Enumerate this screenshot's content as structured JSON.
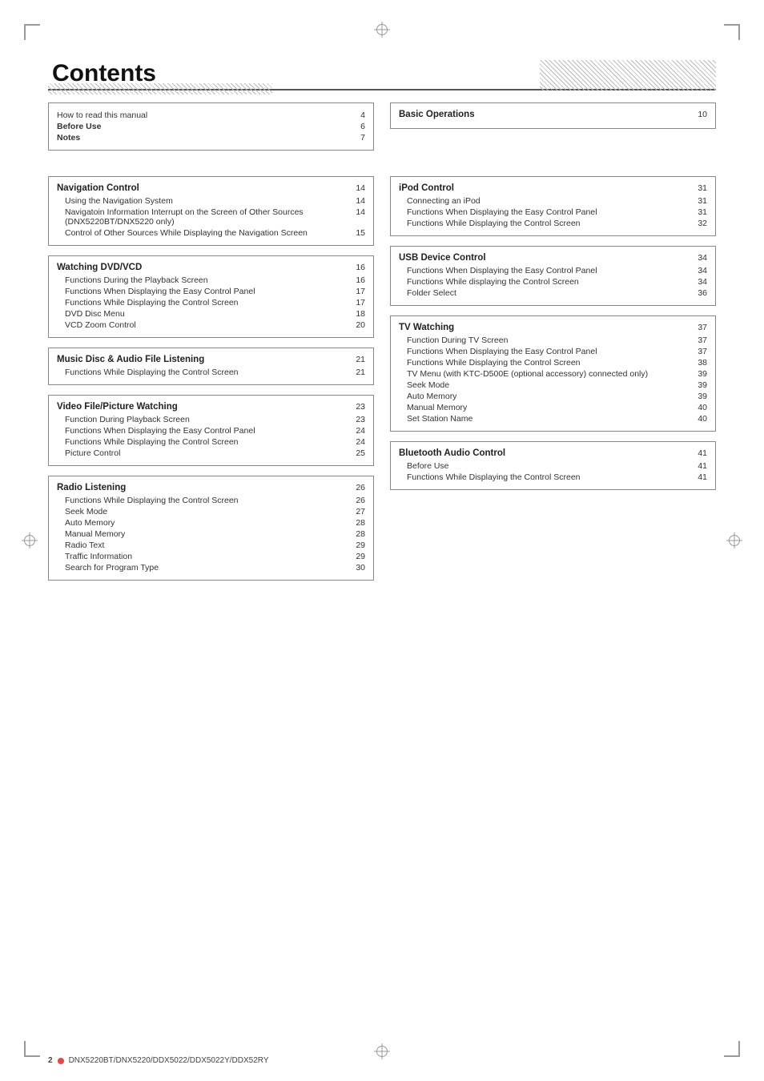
{
  "page": {
    "title": "Contents",
    "footer_page": "2",
    "footer_model": "DNX5220BT/DNX5220/DDX5022/DDX5022Y/DDX52RY"
  },
  "left_top_section": {
    "entries": [
      {
        "label": "How to read this manual",
        "page": "4"
      },
      {
        "label": "Before Use",
        "page": "6"
      },
      {
        "label": "Notes",
        "page": "7"
      }
    ]
  },
  "right_top_section": {
    "title": "Basic Operations",
    "page": "10"
  },
  "sections": [
    {
      "col": "left",
      "title": "Navigation Control",
      "page": "14",
      "entries": [
        {
          "label": "Using the Navigation System",
          "page": "14",
          "indent": 1
        },
        {
          "label": "Navigatoin Information Interrupt on the Screen of Other Sources (DNX5220BT/DNX5220 only)",
          "page": "14",
          "indent": 1
        },
        {
          "label": "Control of Other Sources While Displaying the Navigation Screen",
          "page": "15",
          "indent": 1
        }
      ]
    },
    {
      "col": "left",
      "title": "Watching DVD/VCD",
      "page": "16",
      "entries": [
        {
          "label": "Functions During the Playback Screen",
          "page": "16",
          "indent": 1
        },
        {
          "label": "Functions When Displaying the Easy Control Panel",
          "page": "17",
          "indent": 1
        },
        {
          "label": "Functions While Displaying the Control Screen",
          "page": "17",
          "indent": 1
        },
        {
          "label": "DVD Disc Menu",
          "page": "18",
          "indent": 1
        },
        {
          "label": "VCD Zoom Control",
          "page": "20",
          "indent": 1
        }
      ]
    },
    {
      "col": "left",
      "title": "Music Disc & Audio File Listening",
      "page": "21",
      "entries": [
        {
          "label": "Functions While Displaying the Control Screen",
          "page": "21",
          "indent": 1
        }
      ]
    },
    {
      "col": "left",
      "title": "Video File/Picture Watching",
      "page": "23",
      "entries": [
        {
          "label": "Function During Playback Screen",
          "page": "23",
          "indent": 1
        },
        {
          "label": "Functions When Displaying the Easy Control Panel",
          "page": "24",
          "indent": 1
        },
        {
          "label": "Functions While Displaying the Control Screen",
          "page": "24",
          "indent": 1
        },
        {
          "label": "Picture Control",
          "page": "25",
          "indent": 1
        }
      ]
    },
    {
      "col": "left",
      "title": "Radio Listening",
      "page": "26",
      "entries": [
        {
          "label": "Functions While Displaying the Control Screen",
          "page": "26",
          "indent": 1
        },
        {
          "label": "Seek Mode",
          "page": "27",
          "indent": 1
        },
        {
          "label": "Auto Memory",
          "page": "28",
          "indent": 1
        },
        {
          "label": "Manual Memory",
          "page": "28",
          "indent": 1
        },
        {
          "label": "Radio Text",
          "page": "29",
          "indent": 1
        },
        {
          "label": "Traffic Information",
          "page": "29",
          "indent": 1
        },
        {
          "label": "Search for Program Type",
          "page": "30",
          "indent": 1
        }
      ]
    },
    {
      "col": "right",
      "title": "iPod Control",
      "page": "31",
      "entries": [
        {
          "label": "Connecting an iPod",
          "page": "31",
          "indent": 1
        },
        {
          "label": "Functions When Displaying the Easy Control Panel",
          "page": "31",
          "indent": 1
        },
        {
          "label": "Functions While Displaying the Control Screen",
          "page": "32",
          "indent": 1
        }
      ]
    },
    {
      "col": "right",
      "title": "USB Device Control",
      "page": "34",
      "entries": [
        {
          "label": "Functions When Displaying the Easy Control Panel",
          "page": "34",
          "indent": 1
        },
        {
          "label": "Functions While displaying the Control Screen",
          "page": "34",
          "indent": 1
        },
        {
          "label": "Folder Select",
          "page": "36",
          "indent": 1
        }
      ]
    },
    {
      "col": "right",
      "title": "TV Watching",
      "page": "37",
      "entries": [
        {
          "label": "Function During TV Screen",
          "page": "37",
          "indent": 1
        },
        {
          "label": "Functions When Displaying the Easy Control Panel",
          "page": "37",
          "indent": 1
        },
        {
          "label": "Functions While Displaying the Control Screen",
          "page": "38",
          "indent": 1
        },
        {
          "label": "TV Menu (with KTC-D500E (optional accessory) connected only)",
          "page": "39",
          "indent": 1
        },
        {
          "label": "Seek Mode",
          "page": "39",
          "indent": 1
        },
        {
          "label": "Auto Memory",
          "page": "39",
          "indent": 1
        },
        {
          "label": "Manual Memory",
          "page": "40",
          "indent": 1
        },
        {
          "label": "Set Station Name",
          "page": "40",
          "indent": 1
        }
      ]
    },
    {
      "col": "right",
      "title": "Bluetooth Audio Control",
      "page": "41",
      "entries": [
        {
          "label": "Before Use",
          "page": "41",
          "indent": 1
        },
        {
          "label": "Functions While Displaying the Control Screen",
          "page": "41",
          "indent": 1
        }
      ]
    }
  ]
}
